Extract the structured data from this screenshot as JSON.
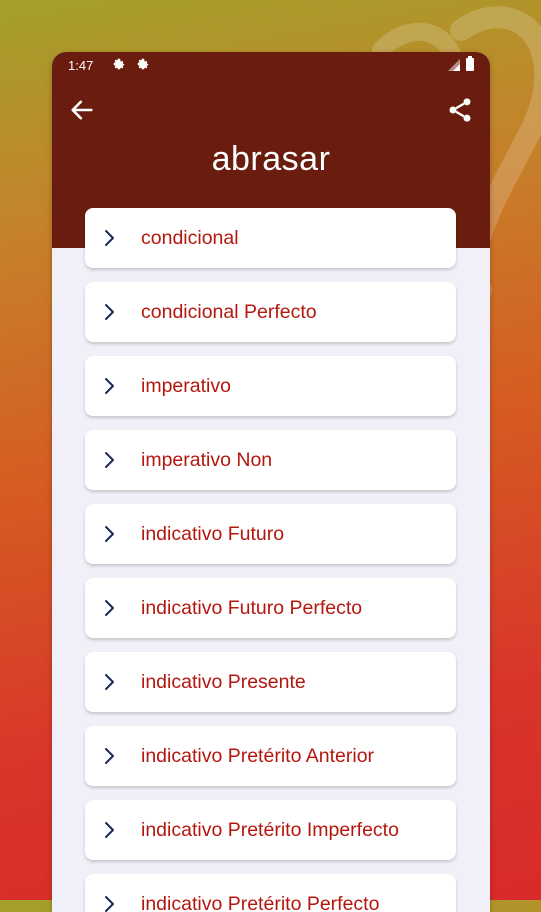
{
  "status": {
    "time": "1:47"
  },
  "header": {
    "title": "abrasar"
  },
  "items": [
    {
      "label": "condicional"
    },
    {
      "label": "condicional Perfecto"
    },
    {
      "label": "imperativo"
    },
    {
      "label": "imperativo Non"
    },
    {
      "label": "indicativo Futuro"
    },
    {
      "label": "indicativo Futuro Perfecto"
    },
    {
      "label": "indicativo Presente"
    },
    {
      "label": "indicativo Pretérito Anterior"
    },
    {
      "label": "indicativo Pretérito Imperfecto"
    },
    {
      "label": "indicativo Pretérito Perfecto"
    }
  ],
  "colors": {
    "header": "#6a1d0e",
    "label": "#b5170e",
    "chevron": "#1c2a5a",
    "list_bg": "#f1f0f8"
  },
  "icons": {
    "back": "arrow-left-icon",
    "share": "share-icon",
    "chevron": "chevron-right-icon",
    "settings": "gear-icon"
  }
}
